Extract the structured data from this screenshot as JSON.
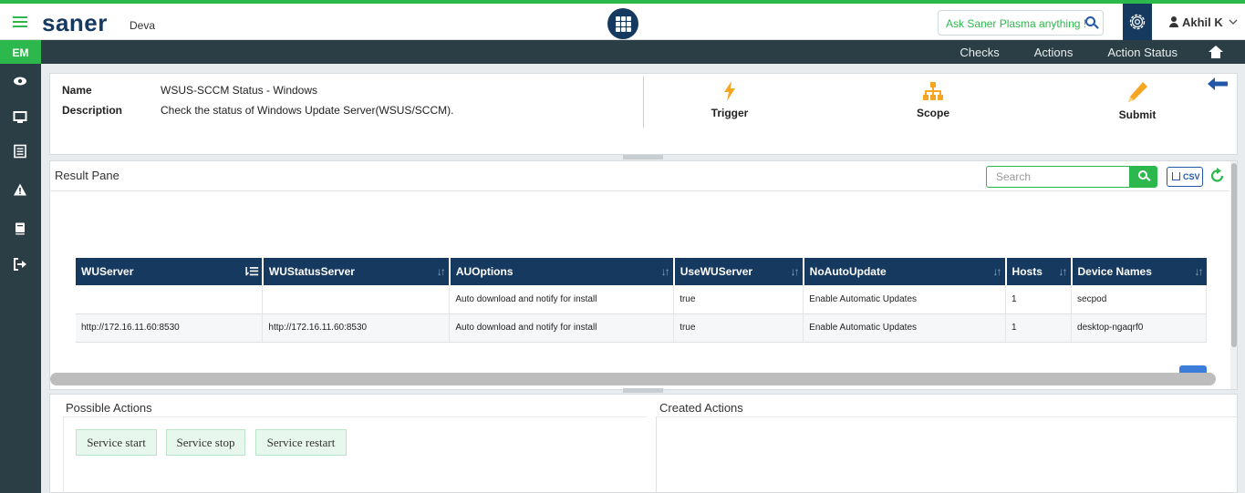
{
  "app": {
    "brand": "saner",
    "tenant": "Deva",
    "ask_label": "Ask Saner Plasma anything !",
    "user": "Akhil K"
  },
  "nav": {
    "module": "EM",
    "links": [
      "Checks",
      "Actions",
      "Action Status"
    ]
  },
  "check": {
    "name_label": "Name",
    "name_value": "WSUS-SCCM Status - Windows",
    "desc_label": "Description",
    "desc_value": "Check the status of Windows Update Server(WSUS/SCCM).",
    "actions": {
      "trigger": "Trigger",
      "scope": "Scope",
      "submit": "Submit"
    }
  },
  "result": {
    "title": "Result Pane",
    "search_placeholder": "Search",
    "csv_label": "CSV",
    "columns": [
      "WUServer",
      "WUStatusServer",
      "AUOptions",
      "UseWUServer",
      "NoAutoUpdate",
      "Hosts",
      "Device Names"
    ],
    "rows": [
      [
        "",
        "",
        "Auto download and notify for install",
        "true",
        "Enable Automatic Updates",
        "1",
        "secpod"
      ],
      [
        "http://172.16.11.60:8530",
        "http://172.16.11.60:8530",
        "Auto download and notify for install",
        "true",
        "Enable Automatic Updates",
        "1",
        "desktop-ngaqrf0"
      ]
    ]
  },
  "possible_actions": {
    "title": "Possible Actions",
    "buttons": [
      "Service start",
      "Service stop",
      "Service restart"
    ]
  },
  "created_actions": {
    "title": "Created Actions"
  },
  "colors": {
    "brand_green": "#2db84d",
    "navy": "#163a5f",
    "dark_nav": "#2c3e45",
    "orange": "#f5a623"
  }
}
